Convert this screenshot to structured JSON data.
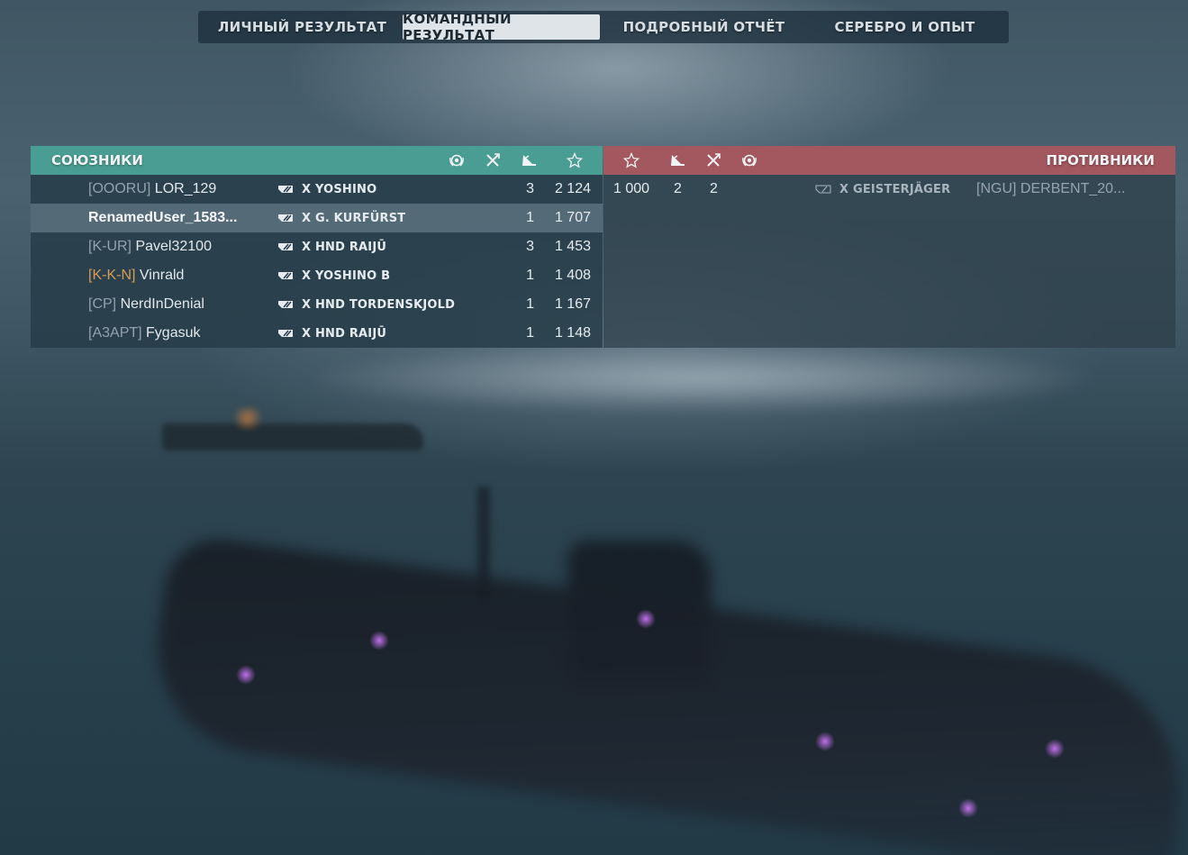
{
  "tabs": [
    {
      "label": "ЛИЧНЫЙ РЕЗУЛЬТАТ",
      "active": false
    },
    {
      "label": "КОМАНДНЫЙ РЕЗУЛЬТАТ",
      "active": true
    },
    {
      "label": "ПОДРОБНЫЙ ОТЧЁТ",
      "active": false
    },
    {
      "label": "СЕРЕБРО И ОПЫТ",
      "active": false
    }
  ],
  "allies": {
    "title": "СОЮЗНИКИ",
    "header_color": "#4a9d92",
    "columns": [
      "wreath-icon",
      "ribbon-plane-icon",
      "ship-sunk-icon",
      "star-icon"
    ],
    "players": [
      {
        "clan": "[OOORU]",
        "name": "LOR_129",
        "ship": "X YOSHINO",
        "kills": "3",
        "score": "2 124",
        "highlight": false,
        "clan_color": "grey"
      },
      {
        "clan": "",
        "name": "RenamedUser_1583...",
        "ship": "X G. KURFÜRST",
        "kills": "1",
        "score": "1 707",
        "highlight": true,
        "clan_color": "grey"
      },
      {
        "clan": "[K-UR]",
        "name": "Pavel32100",
        "ship": "X HND RAIJŪ",
        "kills": "3",
        "score": "1 453",
        "highlight": false,
        "clan_color": "grey"
      },
      {
        "clan": "[K-K-N]",
        "name": "Vinrald",
        "ship": "X YOSHINO B",
        "kills": "1",
        "score": "1 408",
        "highlight": false,
        "clan_color": "#d69a57"
      },
      {
        "clan": "[CP]",
        "name": "NerdInDenial",
        "ship": "X HND TORDENSKJOLD",
        "kills": "1",
        "score": "1 167",
        "highlight": false,
        "clan_color": "grey"
      },
      {
        "clan": "[A3APT]",
        "name": "Fygasuk",
        "ship": "X HND RAIJŪ",
        "kills": "1",
        "score": "1 148",
        "highlight": false,
        "clan_color": "grey"
      }
    ]
  },
  "enemies": {
    "title": "ПРОТИВНИКИ",
    "header_color": "#a3575e",
    "columns": [
      "star-icon",
      "ship-sunk-icon",
      "ribbon-plane-icon",
      "wreath-icon"
    ],
    "players": [
      {
        "score": "1 000",
        "kills": "2",
        "planes": "2",
        "ship": "X GEISTERJÄGER",
        "clan": "[NGU]",
        "name": "DERBENT_20..."
      }
    ]
  }
}
